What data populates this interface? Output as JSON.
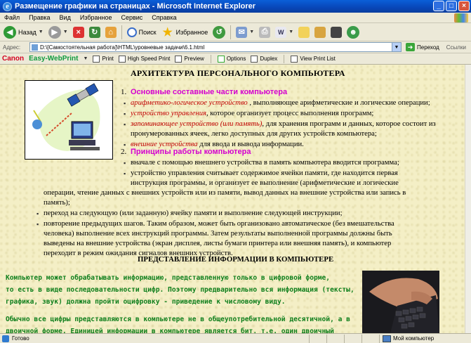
{
  "window": {
    "title": "Размещение графики на страницах - Microsoft Internet Explorer"
  },
  "menu": [
    "Файл",
    "Правка",
    "Вид",
    "Избранное",
    "Сервис",
    "Справка"
  ],
  "toolbar": {
    "back": "Назад",
    "search": "Поиск",
    "favorites": "Избранное"
  },
  "address": {
    "label": "Адрес:",
    "value": "D:\\[Самостоятельная работа]\\HTML\\уровневые задачи\\6.1.html",
    "go": "Переход",
    "links": "Ссылки"
  },
  "canon": {
    "brand": "Canon",
    "product": "Easy-WebPrint",
    "print": "Print",
    "high_speed": "High Speed Print",
    "preview": "Preview",
    "options": "Options",
    "duplex": "Duplex",
    "view_list": "View Print List"
  },
  "page": {
    "title": "АРХИТЕКТУРА ПЕРСОНАЛЬНОГО КОМПЬЮТЕРА",
    "sec1": {
      "num": "1.",
      "head": "Основные составные части компьютера"
    },
    "s1": [
      {
        "term": "арифметико-логическое устройство",
        "text": " , выполняющее арифметические и логические операции;"
      },
      {
        "term": "устройство управления",
        "text": ", которое организует процесс выполнения программ;"
      },
      {
        "term": "запоминающее устройство (или память)",
        "text": ", для хранения программ и данных, которое состоит из"
      },
      {
        "term": "внешние устройства",
        "text": " для ввода и вывода информации."
      }
    ],
    "s1_cont": "пронумерованных ячеек, легко доступных для других устройств компьютера;",
    "sec2": {
      "num": "2.",
      "head": "Принципы работы компьютера"
    },
    "p2_1": "вначале с помощью внешнего устройства в память компьютера вводится программа;",
    "p2_2a": "устройство управления считывает содержимое ячейки памяти, где находится первая",
    "p2_2b": "инструкция программы, и организует ее выполнение (арифметические и логические",
    "p2_2c": "операции, чтение данных с внешних устройств или из памяти, вывод данных на внешние устройства или запись в",
    "p2_2d": "память);",
    "p2_3": "переход на следующую (или заданную) ячейку памяти и выполнение следующей инструкции;",
    "p2_4a": "повторение предыдущих шагов. Таким образом, может быть организовано автоматическое (без вмешательства",
    "p2_4b": "человека) выполнение всех инструкций программы. Затем результаты выполненной программы должны быть",
    "p2_4c": "выведены на внешние устройства (экран дисплея, листы бумаги принтера или внешняя память), и компьютер",
    "p2_4d": "переходит в режим ожидания сигналов внешних устройств.",
    "title2": "ПРЕДСТАВЛЕНИЕ ИНФОРМАЦИИ В КОМПЬЮТЕРЕ",
    "g1": "Компьютер может обрабатывать информацию, представленную только в цифровой форме,",
    "g2": "то есть в виде последовательности цифр. Поэтому предварительно вся информация (тексты,",
    "g3": "графика, звук) должна пройти оцифровку - приведение к числовому виду.",
    "g4": "Обычно все цифры представляются в компьютере не в общеупотребительной десятичной, а в",
    "g5": "двоичной форме. Единицей информации в компьютере является бит, т.е. один двоичный"
  },
  "status": {
    "left": "Готово",
    "zone": "Мой компьютер"
  }
}
